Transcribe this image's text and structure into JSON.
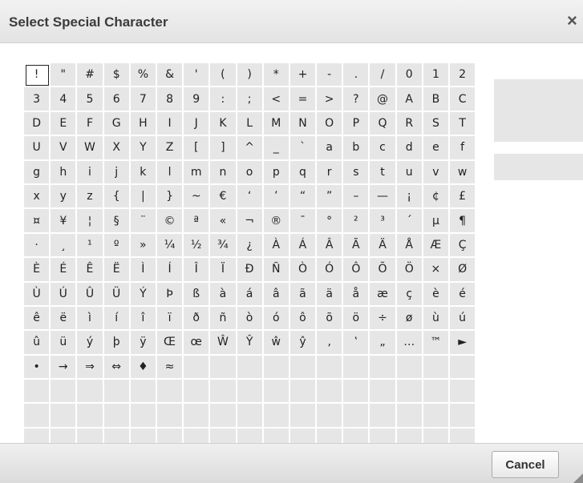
{
  "dialog": {
    "title": "Select Special Character",
    "close_label": "×",
    "cancel_label": "Cancel",
    "selected_index": 0,
    "preview_character": "",
    "preview_name": ""
  },
  "characters": [
    "!",
    "\"",
    "#",
    "$",
    "%",
    "&",
    "'",
    "(",
    ")",
    "*",
    "+",
    "-",
    ".",
    "/",
    "0",
    "1",
    "2",
    "3",
    "4",
    "5",
    "6",
    "7",
    "8",
    "9",
    ":",
    ";",
    "<",
    "=",
    ">",
    "?",
    "@",
    "A",
    "B",
    "C",
    "D",
    "E",
    "F",
    "G",
    "H",
    "I",
    "J",
    "K",
    "L",
    "M",
    "N",
    "O",
    "P",
    "Q",
    "R",
    "S",
    "T",
    "U",
    "V",
    "W",
    "X",
    "Y",
    "Z",
    "[",
    "]",
    "^",
    "_",
    "`",
    "a",
    "b",
    "c",
    "d",
    "e",
    "f",
    "g",
    "h",
    "i",
    "j",
    "k",
    "l",
    "m",
    "n",
    "o",
    "p",
    "q",
    "r",
    "s",
    "t",
    "u",
    "v",
    "w",
    "x",
    "y",
    "z",
    "{",
    "|",
    "}",
    "~",
    "€",
    "‘",
    "’",
    "“",
    "”",
    "–",
    "—",
    "¡",
    "¢",
    "£",
    "¤",
    "¥",
    "¦",
    "§",
    "¨",
    "©",
    "ª",
    "«",
    "¬",
    "®",
    "¯",
    "°",
    "²",
    "³",
    "´",
    "µ",
    "¶",
    "·",
    "¸",
    "¹",
    "º",
    "»",
    "¼",
    "½",
    "¾",
    "¿",
    "À",
    "Á",
    "Â",
    "Ã",
    "Ä",
    "Å",
    "Æ",
    "Ç",
    "È",
    "É",
    "Ê",
    "Ë",
    "Ì",
    "Í",
    "Î",
    "Ï",
    "Ð",
    "Ñ",
    "Ò",
    "Ó",
    "Ô",
    "Õ",
    "Ö",
    "×",
    "Ø",
    "Ù",
    "Ú",
    "Û",
    "Ü",
    "Ý",
    "Þ",
    "ß",
    "à",
    "á",
    "â",
    "ã",
    "ä",
    "å",
    "æ",
    "ç",
    "è",
    "é",
    "ê",
    "ë",
    "ì",
    "í",
    "î",
    "ï",
    "ð",
    "ñ",
    "ò",
    "ó",
    "ô",
    "õ",
    "ö",
    "÷",
    "ø",
    "ù",
    "ú",
    "û",
    "ü",
    "ý",
    "þ",
    "ÿ",
    "Œ",
    "œ",
    "Ŵ",
    "Ŷ",
    "ŵ",
    "ŷ",
    "‚",
    "‛",
    "„",
    "…",
    "™",
    "►",
    "•",
    "→",
    "⇒",
    "⇔",
    "♦",
    "≈"
  ],
  "columns": 17,
  "rows": 16,
  "colors": {
    "cell_bg": "#e6e6e6",
    "titlebar_bg": "#e8e8e8",
    "title_text": "#3b3b3b"
  }
}
